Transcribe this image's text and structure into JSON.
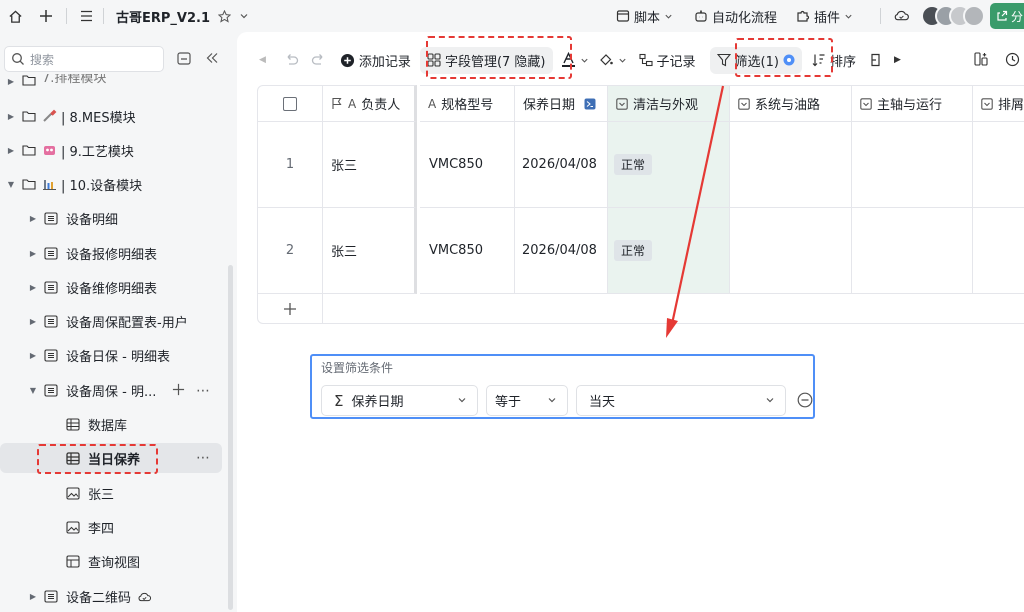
{
  "topbar": {
    "title": "古哥ERP_V2.1",
    "script_label": "脚本",
    "automation_label": "自动化流程",
    "plugin_label": "插件",
    "share_label": "分"
  },
  "sidebar": {
    "search_placeholder": "搜索",
    "cut_item_label": "7.排程模块",
    "mes_label": "| 8.MES模块",
    "process_label": "| 9.工艺模块",
    "equip_label": "| 10.设备模块",
    "items": [
      "设备明细",
      "设备报修明细表",
      "设备维修明细表",
      "设备周保配置表-用户",
      "设备日保 - 明细表",
      "设备周保 - 明..."
    ],
    "sub_items": [
      "数据库",
      "当日保养",
      "张三",
      "李四",
      "查询视图"
    ],
    "qr_label": "设备二维码"
  },
  "toolbar": {
    "add_record": "添加记录",
    "field_manage": "字段管理(7 隐藏)",
    "sub_record": "子记录",
    "filter": "筛选(1)",
    "sort": "排序"
  },
  "table": {
    "columns": [
      "负责人",
      "规格型号",
      "保养日期",
      "清洁与外观",
      "系统与油路",
      "主轴与运行",
      "排屑"
    ],
    "rows": [
      {
        "index": "1",
        "owner": "张三",
        "model": "VMC850",
        "date": "2026/04/08",
        "cleaning": "正常"
      },
      {
        "index": "2",
        "owner": "张三",
        "model": "VMC850",
        "date": "2026/04/08",
        "cleaning": "正常"
      }
    ]
  },
  "filter_panel": {
    "title": "设置筛选条件",
    "field": "保养日期",
    "operator": "等于",
    "value": "当天"
  },
  "colors": {
    "accent": "#4f8ff7",
    "annotation": "#e53935",
    "share_button": "#3a9b6b",
    "selected_column": "#eaf3ef"
  }
}
